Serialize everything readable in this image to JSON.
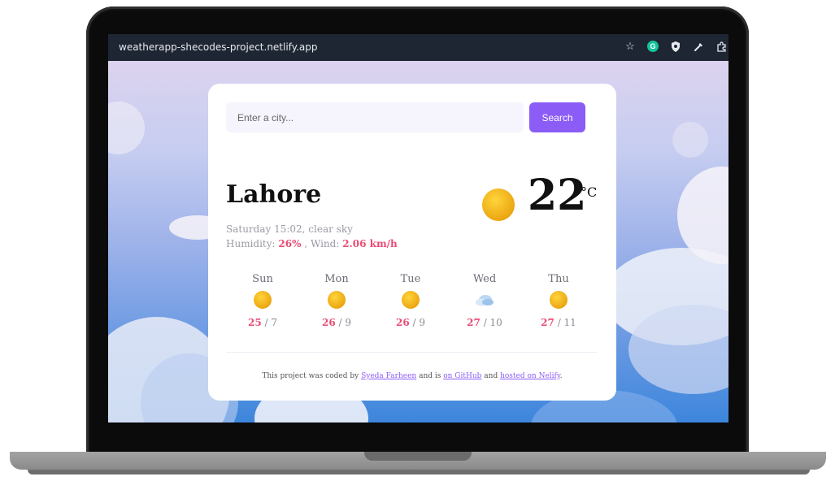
{
  "browser": {
    "url": "weatherapp-shecodes-project.netlify.app",
    "icons": [
      "star-icon",
      "grammarly-icon",
      "shield-extension-icon",
      "eyedropper-icon",
      "puzzle-extension-icon"
    ]
  },
  "search": {
    "placeholder": "Enter a city...",
    "button_label": "Search"
  },
  "current": {
    "city": "Lahore",
    "datetime_desc": "Saturday 15:02, clear sky",
    "humidity_label": "Humidity:",
    "humidity_value": "26%",
    "wind_label": ", Wind:",
    "wind_value": "2.06 km/h",
    "temperature": "22",
    "unit": "°C",
    "icon": "sun-icon"
  },
  "forecast": [
    {
      "day": "Sun",
      "max": "25",
      "min": "/ 7",
      "icon": "sun-icon"
    },
    {
      "day": "Mon",
      "max": "26",
      "min": "/ 9",
      "icon": "sun-icon"
    },
    {
      "day": "Tue",
      "max": "26",
      "min": "/ 9",
      "icon": "sun-icon"
    },
    {
      "day": "Wed",
      "max": "27",
      "min": "/ 10",
      "icon": "cloud-icon"
    },
    {
      "day": "Thu",
      "max": "27",
      "min": "/ 11",
      "icon": "sun-icon"
    }
  ],
  "footer": {
    "prefix": "This project was coded by",
    "author": "Syeda Farheen",
    "middle": "and is",
    "github": "on GitHub",
    "and": "and",
    "hosted": "hosted on Nelify",
    "end": "."
  },
  "colors": {
    "accent": "#ea4b73",
    "button": "#8b5cf6",
    "sun": "#f5b014"
  }
}
